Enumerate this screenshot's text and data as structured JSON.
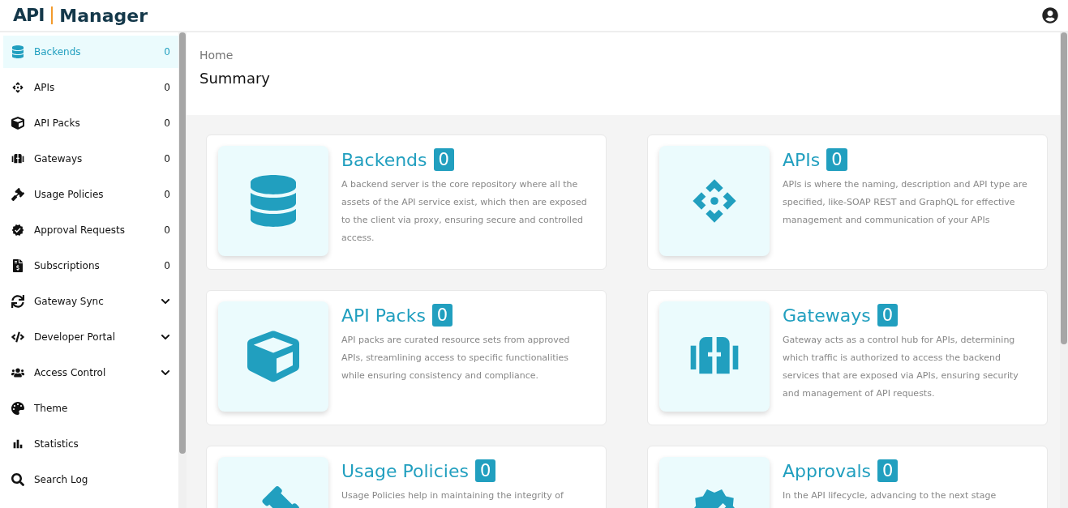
{
  "logo": {
    "mark": "API",
    "name": "Manager"
  },
  "sidebar": {
    "items": [
      {
        "kind": "count",
        "label": "Backends",
        "count": "0",
        "selected": true
      },
      {
        "kind": "count",
        "label": "APIs",
        "count": "0",
        "selected": false
      },
      {
        "kind": "count",
        "label": "API Packs",
        "count": "0",
        "selected": false
      },
      {
        "kind": "count",
        "label": "Gateways",
        "count": "0",
        "selected": false
      },
      {
        "kind": "count",
        "label": "Usage Policies",
        "count": "0",
        "selected": false
      },
      {
        "kind": "count",
        "label": "Approval Requests",
        "count": "0",
        "selected": false
      },
      {
        "kind": "count",
        "label": "Subscriptions",
        "count": "0",
        "selected": false
      },
      {
        "kind": "expandable",
        "label": "Gateway Sync",
        "expanded": false,
        "selected": false
      },
      {
        "kind": "expandable",
        "label": "Developer Portal",
        "expanded": false,
        "selected": false
      },
      {
        "kind": "expandable",
        "label": "Access Control",
        "expanded": false,
        "selected": false
      },
      {
        "kind": "plain",
        "label": "Theme",
        "selected": false
      },
      {
        "kind": "plain",
        "label": "Statistics",
        "selected": false
      },
      {
        "kind": "plain",
        "label": "Search Log",
        "selected": false
      }
    ]
  },
  "breadcrumb": "Home",
  "page_title": "Summary",
  "cards": [
    {
      "title": "Backends",
      "count": "0",
      "description": "A backend server is the core repository where all the assets of the API service exist, which then are exposed to the client via proxy, ensuring secure and controlled access."
    },
    {
      "title": "APIs",
      "count": "0",
      "description": "APIs is where the naming, description and API type are specified, like-SOAP REST and GraphQL for effective management and communication of your APIs"
    },
    {
      "title": "API Packs",
      "count": "0",
      "description": "API packs are curated resource sets from approved APIs, streamlining access to specific functionalities while ensuring consistency and compliance."
    },
    {
      "title": "Gateways",
      "count": "0",
      "description": "Gateway acts as a control hub for APIs, determining which traffic is authorized to access the backend services that are exposed via APIs, ensuring security and management of API requests."
    },
    {
      "title": "Usage Policies",
      "count": "0",
      "description": "Usage Policies help in maintaining the integrity of"
    },
    {
      "title": "Approvals",
      "count": "0",
      "description": "In the API lifecycle, advancing to the next stage"
    }
  ]
}
